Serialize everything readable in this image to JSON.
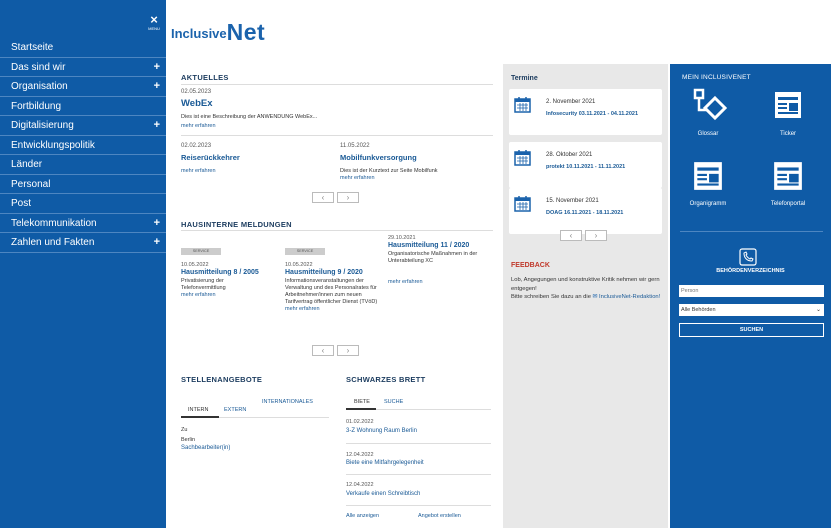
{
  "sidebar": {
    "menu_label": "MENU",
    "items": [
      {
        "label": "Startseite",
        "expand": ""
      },
      {
        "label": "Das sind wir",
        "expand": "+"
      },
      {
        "label": "Organisation",
        "expand": "+"
      },
      {
        "label": "Fortbildung",
        "expand": ""
      },
      {
        "label": "Digitalisierung",
        "expand": "+"
      },
      {
        "label": "Entwicklungspolitik",
        "expand": ""
      },
      {
        "label": "Länder",
        "expand": ""
      },
      {
        "label": "Personal",
        "expand": ""
      },
      {
        "label": "Post",
        "expand": ""
      },
      {
        "label": "Telekommunikation",
        "expand": "+"
      },
      {
        "label": "Zahlen und Fakten",
        "expand": "+"
      }
    ]
  },
  "logo": {
    "inclusive": "Inclusive",
    "net": "Net"
  },
  "aktuelles": {
    "heading": "AKTUELLES",
    "top": {
      "date": "02.05.2023",
      "title": "WebEx",
      "text": "Dies ist eine Beschreibung der ANWENDUNG WebEx...",
      "more": "mehr erfahren"
    },
    "items": [
      {
        "date": "02.02.2023",
        "title": "Reiserückkehrer",
        "text": "",
        "more": "mehr erfahren"
      },
      {
        "date": "11.05.2022",
        "title": "Mobilfunkversorgung",
        "text": "Dies ist der Kurztext zur Seite Mobilfunk",
        "more": "mehr erfahren"
      }
    ]
  },
  "meldungen": {
    "heading": "HAUSINTERNE MELDUNGEN",
    "items": [
      {
        "badge": "SERVICE",
        "date": "10.05.2022",
        "title": "Hausmitteilung 8 / 2005",
        "text": "Privatisierung der Telefonvermittlung",
        "more": "mehr erfahren"
      },
      {
        "badge": "SERVICE",
        "date": "10.05.2022",
        "title": "Hausmitteilung 9 / 2020",
        "text": "Informationsveranstaltungen der Verwaltung und des Personalrates für Arbeitnehmer/innen zum neuen Tarifvertrag öffentlicher Dienst (TVöD)",
        "more": "mehr erfahren"
      },
      {
        "badge": "",
        "date": "29.10.2021",
        "title": "Hausmitteilung 11 / 2020",
        "text": "Organisatorische Maßnahmen in der Unterabteilung XC",
        "more": "mehr erfahren"
      }
    ]
  },
  "pager": {
    "prev": "‹",
    "next": "›"
  },
  "stellen": {
    "heading": "STELLENANGEBOTE",
    "tabs": [
      "INTERN",
      "EXTERN",
      "INTERNATIONALES"
    ],
    "item": {
      "line1": "Zu",
      "line2": "Berlin",
      "title": "Sachbearbeiter(in)"
    }
  },
  "brett": {
    "heading": "SCHWARZES BRETT",
    "tabs": [
      "BIETE",
      "SUCHE"
    ],
    "items": [
      {
        "date": "01.02.2022",
        "title": "3-Z Wohnung Raum Berlin"
      },
      {
        "date": "12.04.2022",
        "title": "Biete eine Mitfahrgelegenheit"
      },
      {
        "date": "12.04.2022",
        "title": "Verkaufe einen Schreibtisch"
      }
    ],
    "all": "Alle anzeigen",
    "create": "Angebot erstellen"
  },
  "termine": {
    "heading": "Termine",
    "items": [
      {
        "date": "2. November 2021",
        "name": "Infosecurity 03.11.2021 - 04.11.2021"
      },
      {
        "date": "28. Oktober 2021",
        "name": "protekt 10.11.2021 - 11.11.2021"
      },
      {
        "date": "15. November 2021",
        "name": "DOAG 16.11.2021 - 18.11.2021"
      }
    ]
  },
  "feedback": {
    "heading": "FEEDBACK",
    "text1": "Lob, Angegungen und konstruktive Kritik nehmen wir gern entgegen!",
    "text2": "Bitte schreiben Sie dazu an die",
    "link": "InclusiveNet-Redaktion!"
  },
  "mein": {
    "heading": "MEIN INCLUSIVENET",
    "tiles": [
      "Glossar",
      "Ticker",
      "Organigramm",
      "Telefonportal"
    ],
    "behoerden": "BEHÖRDENVERZEICHNIS",
    "person_placeholder": "Person",
    "select": "Alle Behörden",
    "search": "SUCHEN"
  },
  "colors": {
    "brand": "#0f5ba6",
    "link": "#1a5a96"
  }
}
